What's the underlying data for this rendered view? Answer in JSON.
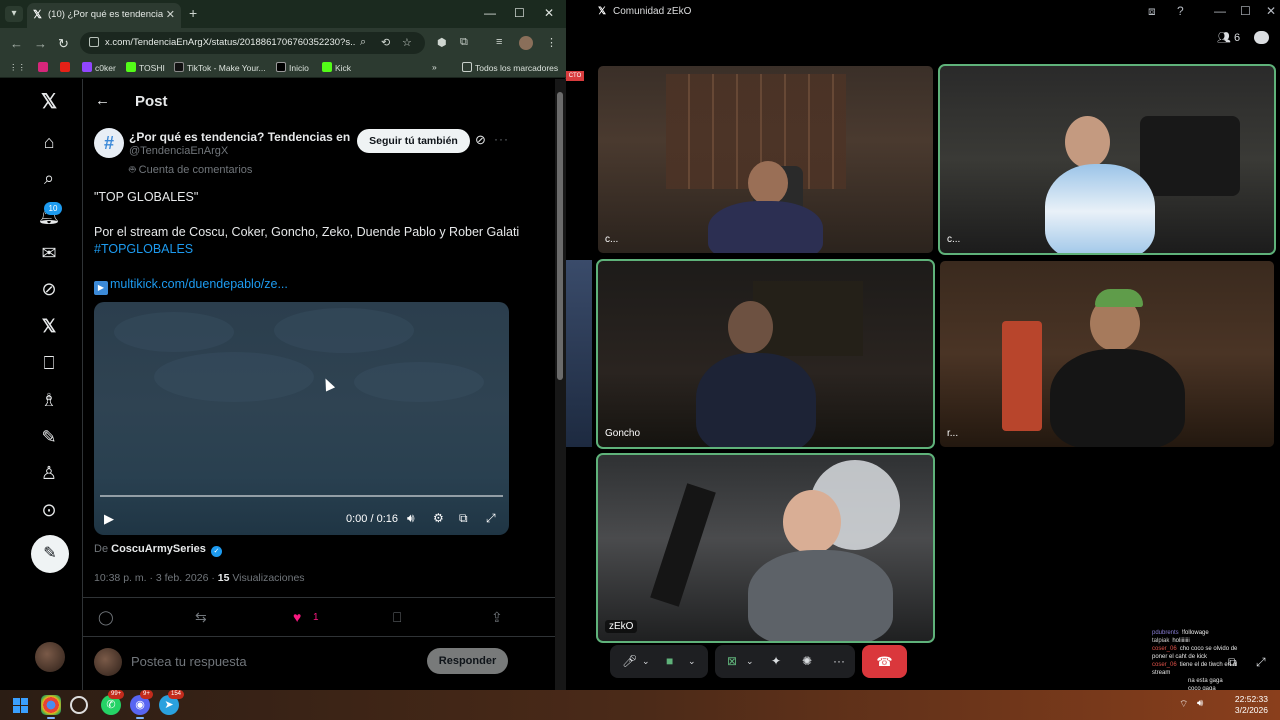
{
  "browser": {
    "tab_title": "(10) ¿Por qué es tendencia? Ten",
    "url": "x.com/TendenciaEnArgX/status/2018861706760352230?s...",
    "bookmarks": [
      "c0ker",
      "TOSHI",
      "TikTok - Make Your...",
      "Inicio",
      "Kick"
    ],
    "all_bookmarks": "Todos los marcadores"
  },
  "x": {
    "header_title": "Post",
    "notif_count": "10",
    "author": {
      "name": "¿Por qué es tendencia? Tendencias en Ar...",
      "handle": "@TendenciaEnArgX",
      "automated": "Cuenta de comentarios",
      "follow_label": "Seguir tú también"
    },
    "post": {
      "line1": "\"TOP GLOBALES\"",
      "line2": "Por el stream de Coscu, Coker, Goncho, Zeko, Duende Pablo y Rober Galati",
      "hashtag": "#TOPGLOBALES",
      "link": "multikick.com/duendepablo/ze..."
    },
    "video": {
      "time": "0:00 / 0:16",
      "progress": 0
    },
    "from_prefix": "De",
    "from_author": "CoscuArmySeries",
    "meta": {
      "time": "10:38 p. m. · 3 feb. 2026 · ",
      "views": "15",
      "views_label": " Visualizaciones"
    },
    "like_count": "1",
    "reply_placeholder": "Postea tu respuesta",
    "reply_button": "Responder"
  },
  "discord": {
    "title": "Comunidad zEkO",
    "participant_count": "6",
    "live_tag": "CTO",
    "tiles": [
      {
        "label": "c..."
      },
      {
        "label": "c..."
      },
      {
        "label": "Goncho"
      },
      {
        "label": "r..."
      },
      {
        "label": "zEkO"
      }
    ],
    "chat": [
      {
        "user": "pdubrents",
        "msg": "!followage",
        "color": "#8a7fd6"
      },
      {
        "user": "talpiak",
        "msg": "holiiiiiii",
        "color": "#cfcfcf"
      },
      {
        "user": "coser_06",
        "msg": "cho coco se olvido de",
        "color": "#e0524a"
      },
      {
        "user": "",
        "msg": "poner el caht de kick",
        "color": "#e6e6e6"
      },
      {
        "user": "coser_06",
        "msg": "tiene el de tiwch en el",
        "color": "#e0524a"
      },
      {
        "user": "",
        "msg": "stream",
        "color": "#e6e6e6"
      },
      {
        "user": "",
        "msg": "na esta gaga",
        "color": "#8a7fd6"
      },
      {
        "user": "",
        "msg": "coco gaga",
        "color": "#e6e6e6"
      }
    ]
  },
  "taskbar": {
    "whatsapp_badge": "99+",
    "discord_badge": "9+",
    "telegram_badge": "154",
    "clock_time": "22:52:33",
    "clock_date": "3/2/2026"
  }
}
